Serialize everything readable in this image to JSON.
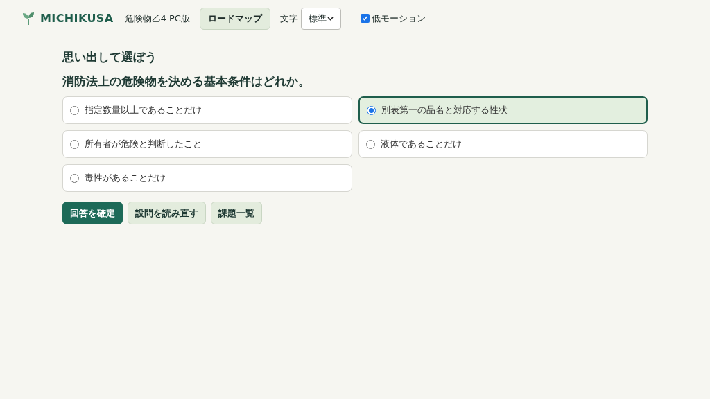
{
  "header": {
    "brand": "MICHIKUSA",
    "subtitle": "危険物乙4 PC版",
    "roadmap_button": "ロードマップ",
    "font_size": {
      "label": "文字",
      "value": "標準"
    },
    "low_motion": {
      "label": "低モーション",
      "checked": true
    }
  },
  "quiz": {
    "heading": "思い出して選ぼう",
    "question": "消防法上の危険物を決める基本条件はどれか。",
    "options": [
      {
        "label": "指定数量以上であることだけ",
        "selected": false
      },
      {
        "label": "別表第一の品名と対応する性状",
        "selected": true
      },
      {
        "label": "所有者が危険と判断したこと",
        "selected": false
      },
      {
        "label": "液体であることだけ",
        "selected": false
      },
      {
        "label": "毒性があることだけ",
        "selected": false
      }
    ],
    "buttons": [
      {
        "label": "回答を確定",
        "kind": "primary"
      },
      {
        "label": "設問を読み直す",
        "kind": "secondary"
      },
      {
        "label": "課題一覧",
        "kind": "secondary"
      }
    ]
  }
}
